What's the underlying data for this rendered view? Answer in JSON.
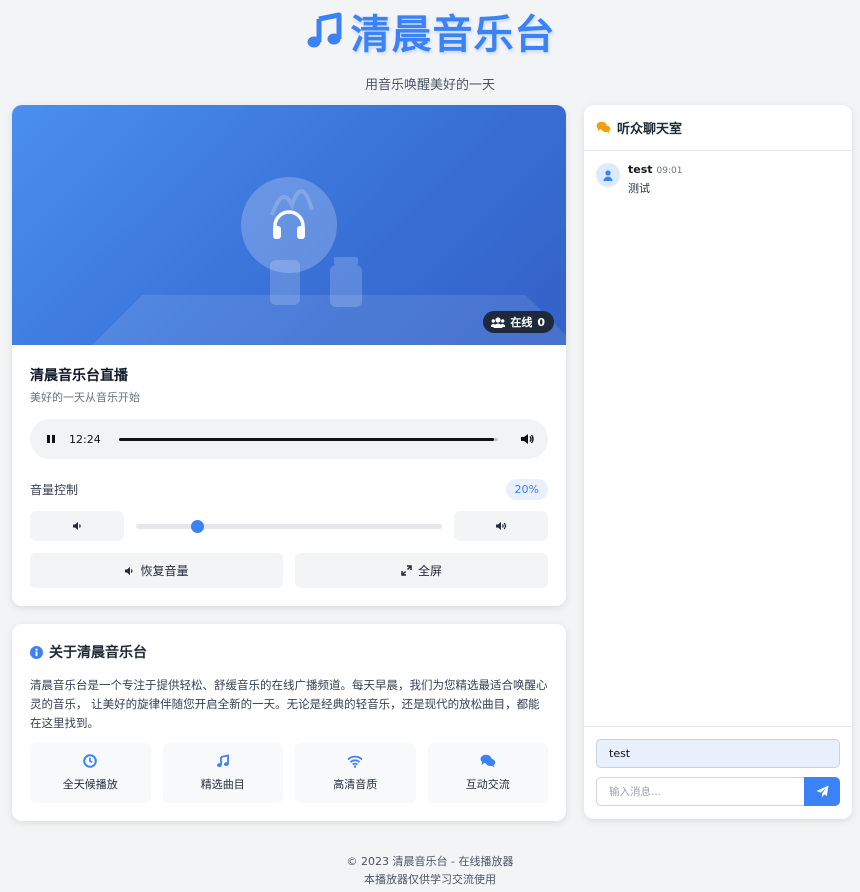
{
  "header": {
    "title": "清晨音乐台",
    "subtitle": "用音乐唤醒美好的一天"
  },
  "player": {
    "online_label": "在线",
    "online_count": "0",
    "stream_title": "清晨音乐台直播",
    "stream_subtitle": "美好的一天从音乐开始",
    "current_time": "12:24",
    "progress": 0.99,
    "volume_label": "音量控制",
    "volume_percent": "20%",
    "volume_value": 0.2,
    "restore_label": "恢复音量",
    "fullscreen_label": "全屏"
  },
  "about": {
    "title": "关于清晨音乐台",
    "text": "清晨音乐台是一个专注于提供轻松、舒缓音乐的在线广播频道。每天早晨，我们为您精选最适合唤醒心灵的音乐， 让美好的旋律伴随您开启全新的一天。无论是经典的轻音乐，还是现代的放松曲目，都能在这里找到。",
    "features": [
      {
        "icon": "clock-icon",
        "label": "全天候播放"
      },
      {
        "icon": "music-note-icon",
        "label": "精选曲目"
      },
      {
        "icon": "wifi-icon",
        "label": "高清音质"
      },
      {
        "icon": "comments-icon",
        "label": "互动交流"
      }
    ]
  },
  "chat": {
    "title": "听众聊天室",
    "messages": [
      {
        "user": "test",
        "time": "09:01",
        "text": "测试"
      }
    ],
    "name_value": "test",
    "message_placeholder": "输入消息..."
  },
  "footer": {
    "line1": "© 2023 清晨音乐台 - 在线播放器",
    "line2": "本播放器仅供学习交流使用"
  },
  "colors": {
    "accent": "#3b82f6",
    "chat_icon": "#f59e0b"
  }
}
